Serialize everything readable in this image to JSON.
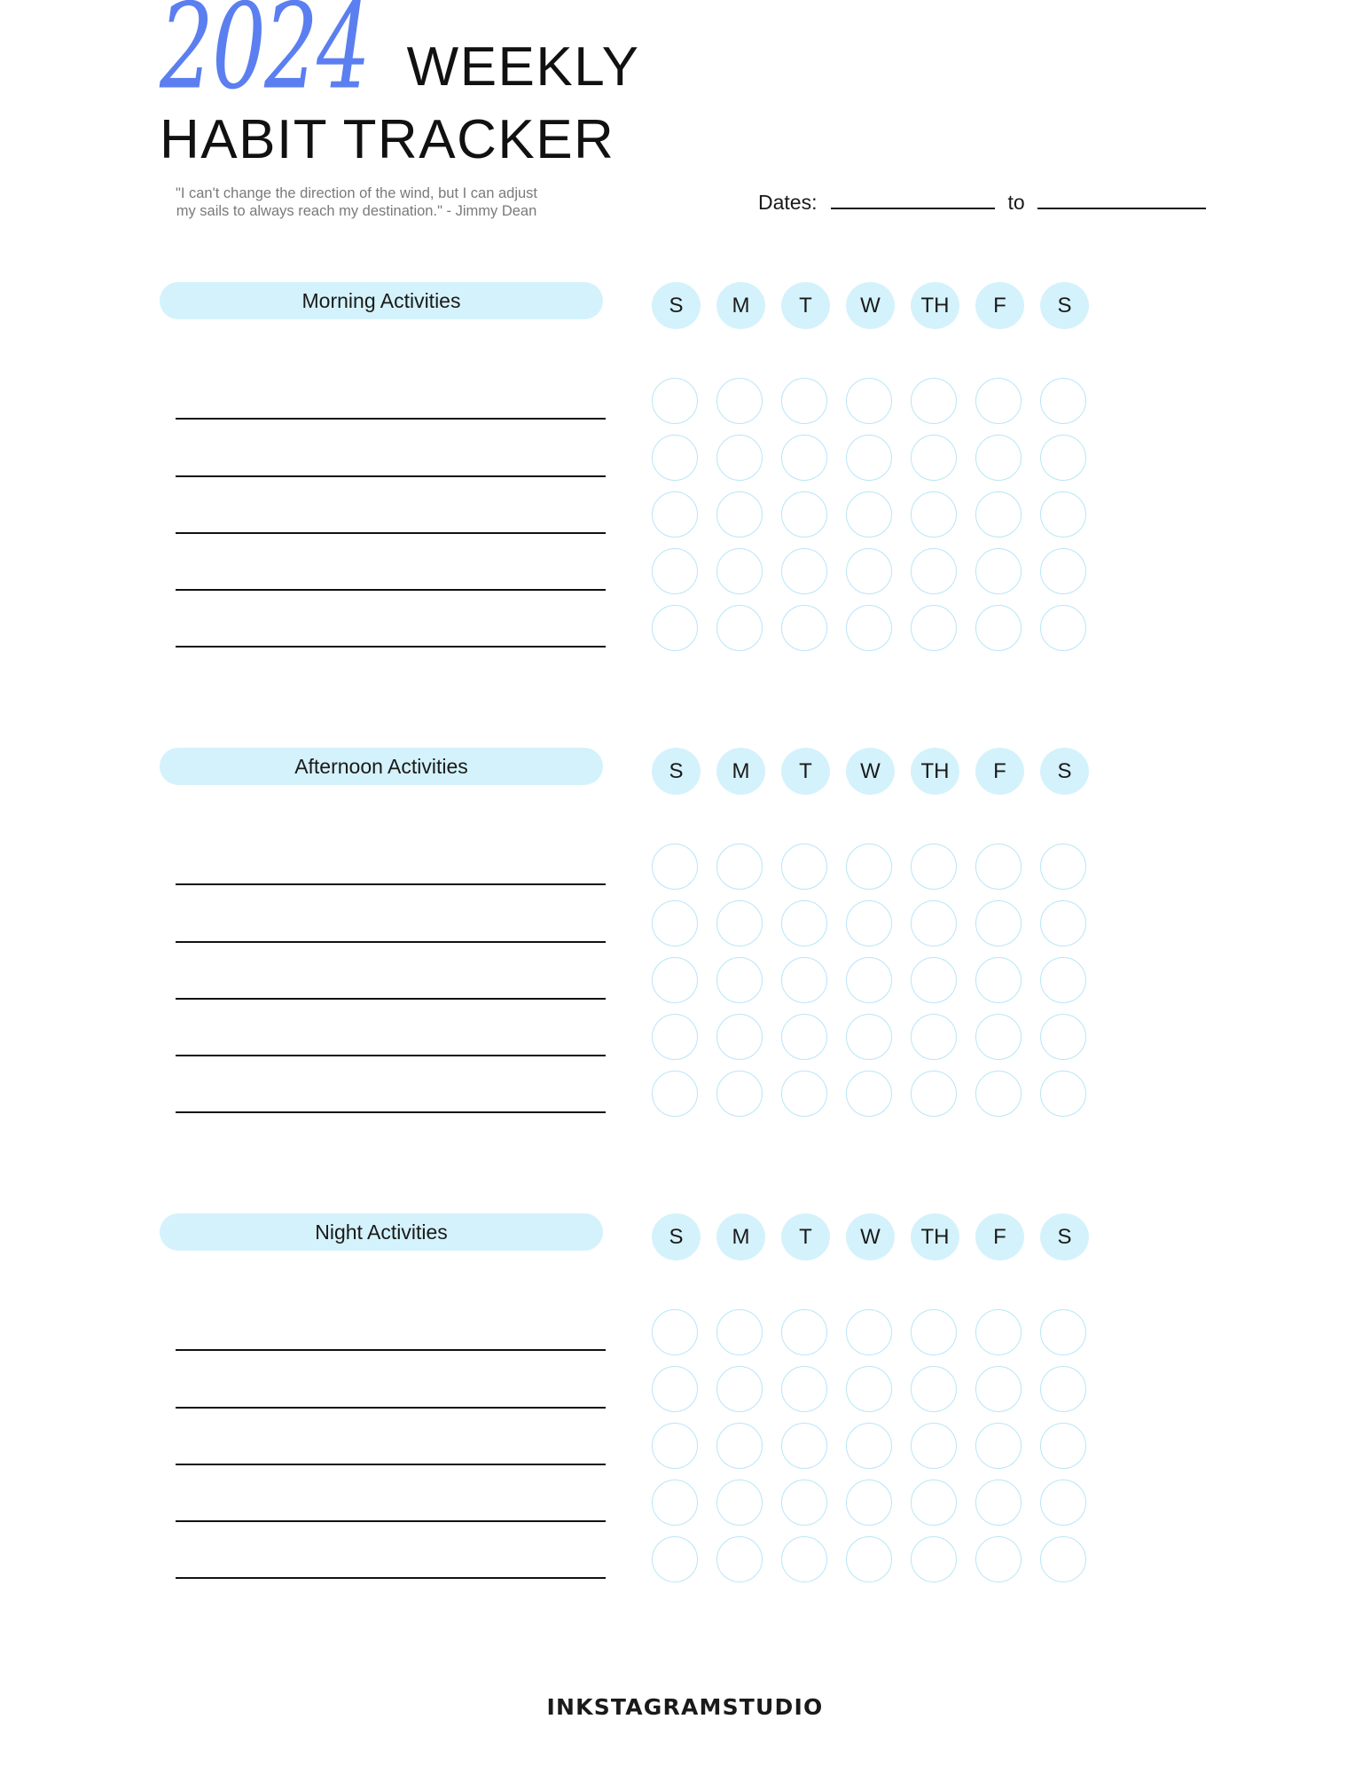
{
  "header": {
    "year": "2024",
    "title_line1": "WEEKLY",
    "title_line2": "HABIT TRACKER",
    "quote": "\"I can't change the direction of the wind, but I can adjust my sails to always reach my destination.\" - Jimmy Dean"
  },
  "dates": {
    "label": "Dates:",
    "start_value": "",
    "to_label": "to",
    "end_value": ""
  },
  "days": [
    "S",
    "M",
    "T",
    "W",
    "TH",
    "F",
    "S"
  ],
  "sections": [
    {
      "title": "Morning Activities",
      "habits": [
        "",
        "",
        "",
        "",
        ""
      ]
    },
    {
      "title": "Afternoon Activities",
      "habits": [
        "",
        "",
        "",
        "",
        ""
      ]
    },
    {
      "title": "Night Activities",
      "habits": [
        "",
        "",
        "",
        "",
        ""
      ]
    }
  ],
  "footer": {
    "brand": "INKSTAGRAMSTUDIO"
  },
  "colors": {
    "accent_pill": "#d4f2fb",
    "circle_outline": "#b8e6f7",
    "year_blue": "#5b7ff0",
    "ink": "#111111",
    "quote_gray": "#7a7a7a"
  }
}
